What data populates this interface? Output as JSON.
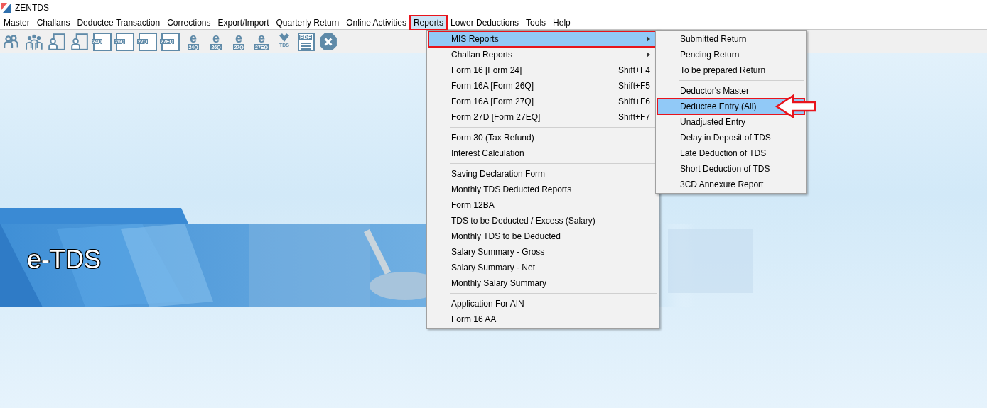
{
  "window": {
    "title": "ZENTDS"
  },
  "menu_bar": [
    {
      "label": "Master",
      "selected": false,
      "annotated": false
    },
    {
      "label": "Challans",
      "selected": false,
      "annotated": false
    },
    {
      "label": "Deductee Transaction",
      "selected": false,
      "annotated": false
    },
    {
      "label": "Corrections",
      "selected": false,
      "annotated": false
    },
    {
      "label": "Export/Import",
      "selected": false,
      "annotated": false
    },
    {
      "label": "Quarterly Return",
      "selected": false,
      "annotated": false
    },
    {
      "label": "Online Activities",
      "selected": false,
      "annotated": false
    },
    {
      "label": "Reports",
      "selected": true,
      "annotated": true
    },
    {
      "label": "Lower Deductions",
      "selected": false,
      "annotated": false
    },
    {
      "label": "Tools",
      "selected": false,
      "annotated": false
    },
    {
      "label": "Help",
      "selected": false,
      "annotated": false
    }
  ],
  "toolbar": [
    {
      "kind": "person"
    },
    {
      "kind": "group"
    },
    {
      "kind": "person-doc"
    },
    {
      "kind": "person-doc"
    },
    {
      "kind": "form",
      "label": "24Q"
    },
    {
      "kind": "form",
      "label": "26Q"
    },
    {
      "kind": "form",
      "label": "27Q"
    },
    {
      "kind": "form",
      "label": "27EQ"
    },
    {
      "kind": "e-form",
      "letter": "e",
      "label": "24Q"
    },
    {
      "kind": "e-form",
      "letter": "e",
      "label": "26Q"
    },
    {
      "kind": "e-form",
      "letter": "e",
      "label": "27Q"
    },
    {
      "kind": "e-form",
      "letter": "e",
      "label": "27EQ"
    },
    {
      "kind": "tds",
      "label": "TDS"
    },
    {
      "kind": "pdf",
      "label": "PDF"
    },
    {
      "kind": "close"
    }
  ],
  "banner": {
    "title": "e-TDS"
  },
  "reports_menu": {
    "groups": [
      [
        {
          "label": "MIS Reports",
          "submenu": true,
          "selected": true,
          "annotated": true
        },
        {
          "label": "Challan Reports",
          "submenu": true,
          "selected": false,
          "annotated": false
        },
        {
          "label": "Form 16 [Form 24]",
          "shortcut": "Shift+F4",
          "selected": false,
          "annotated": false
        },
        {
          "label": "Form 16A [Form 26Q]",
          "shortcut": "Shift+F5",
          "selected": false,
          "annotated": false
        },
        {
          "label": "Form 16A [Form 27Q]",
          "shortcut": "Shift+F6",
          "selected": false,
          "annotated": false
        },
        {
          "label": "Form 27D [Form 27EQ]",
          "shortcut": "Shift+F7",
          "selected": false,
          "annotated": false
        }
      ],
      [
        {
          "label": "Form 30 (Tax Refund)",
          "selected": false,
          "annotated": false
        },
        {
          "label": "Interest Calculation",
          "selected": false,
          "annotated": false
        }
      ],
      [
        {
          "label": "Saving Declaration Form",
          "selected": false,
          "annotated": false
        },
        {
          "label": "Monthly TDS Deducted Reports",
          "selected": false,
          "annotated": false
        },
        {
          "label": "Form 12BA",
          "selected": false,
          "annotated": false
        },
        {
          "label": "TDS to be Deducted / Excess  (Salary)",
          "selected": false,
          "annotated": false
        },
        {
          "label": "Monthly TDS to be Deducted",
          "selected": false,
          "annotated": false
        },
        {
          "label": "Salary Summary - Gross",
          "selected": false,
          "annotated": false
        },
        {
          "label": "Salary Summary - Net",
          "selected": false,
          "annotated": false
        },
        {
          "label": "Monthly Salary Summary",
          "selected": false,
          "annotated": false
        }
      ],
      [
        {
          "label": "Application For AIN",
          "selected": false,
          "annotated": false
        },
        {
          "label": "Form 16 AA",
          "selected": false,
          "annotated": false
        }
      ]
    ]
  },
  "mis_submenu": {
    "groups": [
      [
        {
          "label": "Submitted Return",
          "selected": false,
          "annotated": false
        },
        {
          "label": "Pending Return",
          "selected": false,
          "annotated": false
        },
        {
          "label": "To be prepared Return",
          "selected": false,
          "annotated": false
        }
      ],
      [
        {
          "label": "Deductor's Master",
          "selected": false,
          "annotated": false
        },
        {
          "label": "Deductee Entry (All)",
          "selected": true,
          "annotated": true,
          "pointer": true
        },
        {
          "label": "Unadjusted Entry",
          "selected": false,
          "annotated": false
        },
        {
          "label": "Delay in Deposit of TDS",
          "selected": false,
          "annotated": false
        },
        {
          "label": "Late Deduction of TDS",
          "selected": false,
          "annotated": false
        },
        {
          "label": "Short Deduction of TDS",
          "selected": false,
          "annotated": false
        },
        {
          "label": "3CD Annexure Report",
          "selected": false,
          "annotated": false
        }
      ]
    ]
  }
}
